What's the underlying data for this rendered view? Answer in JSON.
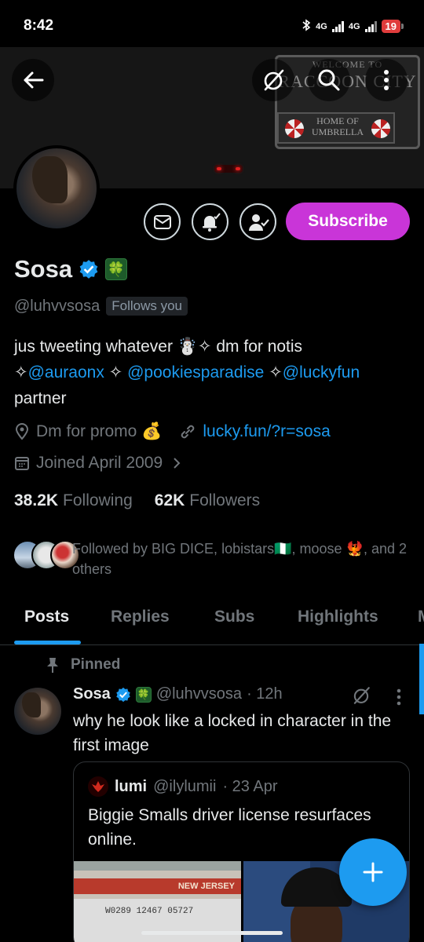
{
  "status_bar": {
    "time": "8:42",
    "battery": "19",
    "network1": "4G",
    "network2": "4G"
  },
  "banner": {
    "sign_small": "WELCOME TO",
    "sign_big": "RACCOON CITY",
    "sign_home": "HOME OF",
    "sign_umbrella": "UMBRELLA"
  },
  "profile": {
    "subscribe_label": "Subscribe",
    "display_name": "Sosa",
    "clover": "🍀",
    "handle": "@luhvvsosa",
    "follows_you": "Follows you",
    "bio_line1": "jus tweeting whatever ☃️✧ dm for notis",
    "bio_prefix1": "✧",
    "bio_link1": "@auraonx",
    "bio_sep1": " ✧ ",
    "bio_link2": "@pookiesparadise",
    "bio_sep2": " ✧",
    "bio_link3": "@luckyfun",
    "bio_line3": "partner",
    "location": "Dm for promo 💰",
    "website": "lucky.fun/?r=sosa",
    "joined": "Joined April 2009",
    "following_count": "38.2K",
    "following_label": "Following",
    "followers_count": "62K",
    "followers_label": "Followers",
    "followed_by": "Followed by BIG DICE, lobistars🇳🇬, moose 🐦‍🔥, and 2 others"
  },
  "tabs": [
    {
      "label": "Posts"
    },
    {
      "label": "Replies"
    },
    {
      "label": "Subs"
    },
    {
      "label": "Highlights"
    },
    {
      "label": "M"
    }
  ],
  "tweet": {
    "pinned_label": "Pinned",
    "name": "Sosa",
    "clover": "🍀",
    "handle": "@luhvvsosa",
    "time": "· 12h",
    "text": "why he look like a locked in character in the first image",
    "quote": {
      "name": "lumi",
      "handle": "@ilylumii",
      "time": "· 23 Apr",
      "text": "Biggie Smalls driver license resurfaces online.",
      "license_state": "NEW JERSEY",
      "license_number": "W0289 12467 05727"
    }
  },
  "colors": {
    "accent": "#1d9bf0",
    "subscribe": "#c935d8",
    "muted": "#71767b"
  }
}
